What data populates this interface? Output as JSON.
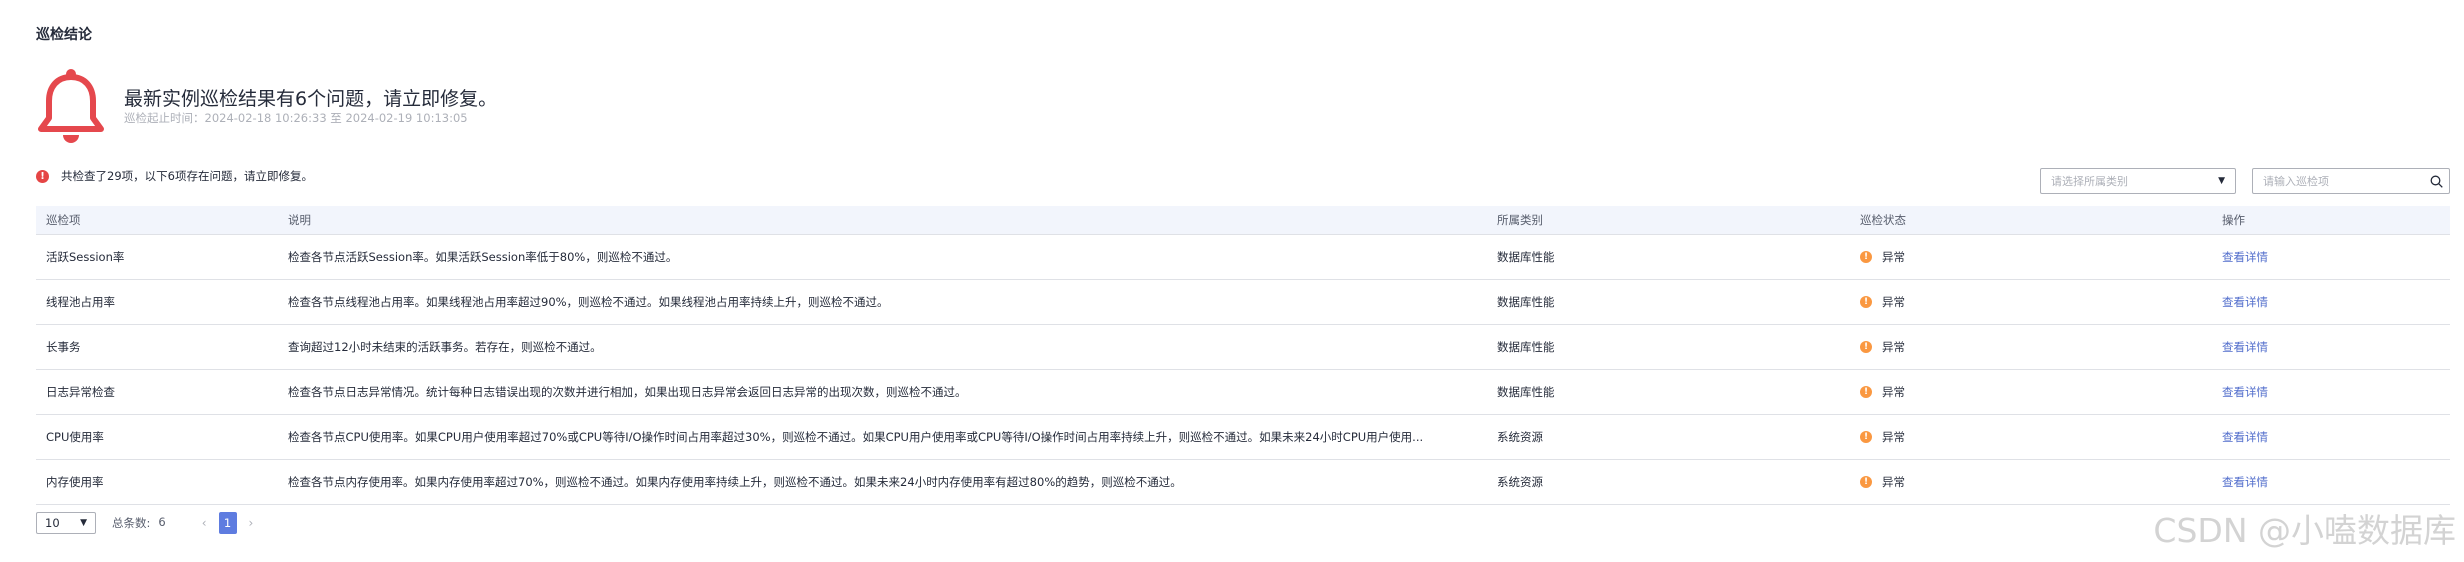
{
  "section_title": "巡检结论",
  "summary": {
    "headline": "最新实例巡检结果有6个问题，请立即修复。",
    "time_range": "巡检起止时间：2024-02-18 10:26:33 至 2024-02-19 10:13:05"
  },
  "notice": "共检查了29项，以下6项存在问题，请立即修复。",
  "filters": {
    "category_placeholder": "请选择所属类别",
    "search_placeholder": "请输入巡检项"
  },
  "table": {
    "headers": [
      "巡检项",
      "说明",
      "所属类别",
      "巡检状态",
      "操作"
    ],
    "rows": [
      {
        "item": "活跃Session率",
        "desc": "检查各节点活跃Session率。如果活跃Session率低于80%，则巡检不通过。",
        "category": "数据库性能",
        "status": "异常",
        "action": "查看详情"
      },
      {
        "item": "线程池占用率",
        "desc": "检查各节点线程池占用率。如果线程池占用率超过90%，则巡检不通过。如果线程池占用率持续上升，则巡检不通过。",
        "category": "数据库性能",
        "status": "异常",
        "action": "查看详情"
      },
      {
        "item": "长事务",
        "desc": "查询超过12小时未结束的活跃事务。若存在，则巡检不通过。",
        "category": "数据库性能",
        "status": "异常",
        "action": "查看详情"
      },
      {
        "item": "日志异常检查",
        "desc": "检查各节点日志异常情况。统计每种日志错误出现的次数并进行相加，如果出现日志异常会返回日志异常的出现次数，则巡检不通过。",
        "category": "数据库性能",
        "status": "异常",
        "action": "查看详情"
      },
      {
        "item": "CPU使用率",
        "desc": "检查各节点CPU使用率。如果CPU用户使用率超过70%或CPU等待I/O操作时间占用率超过30%，则巡检不通过。如果CPU用户使用率或CPU等待I/O操作时间占用率持续上升，则巡检不通过。如果未来24小时CPU用户使用...",
        "category": "系统资源",
        "status": "异常",
        "action": "查看详情"
      },
      {
        "item": "内存使用率",
        "desc": "检查各节点内存使用率。如果内存使用率超过70%，则巡检不通过。如果内存使用率持续上升，则巡检不通过。如果未来24小时内存使用率有超过80%的趋势，则巡检不通过。",
        "category": "系统资源",
        "status": "异常",
        "action": "查看详情"
      }
    ]
  },
  "pagination": {
    "page_size": "10",
    "total_label": "总条数:",
    "total": "6",
    "current_page": "1",
    "prev_icon": "‹",
    "next_icon": "›"
  },
  "watermark": "CSDN @小嗑数据库",
  "colors": {
    "bell": "#e5484d",
    "error": "#e54545",
    "warning": "#fa9841",
    "link": "#526ecc",
    "accent": "#5e7ce0"
  }
}
